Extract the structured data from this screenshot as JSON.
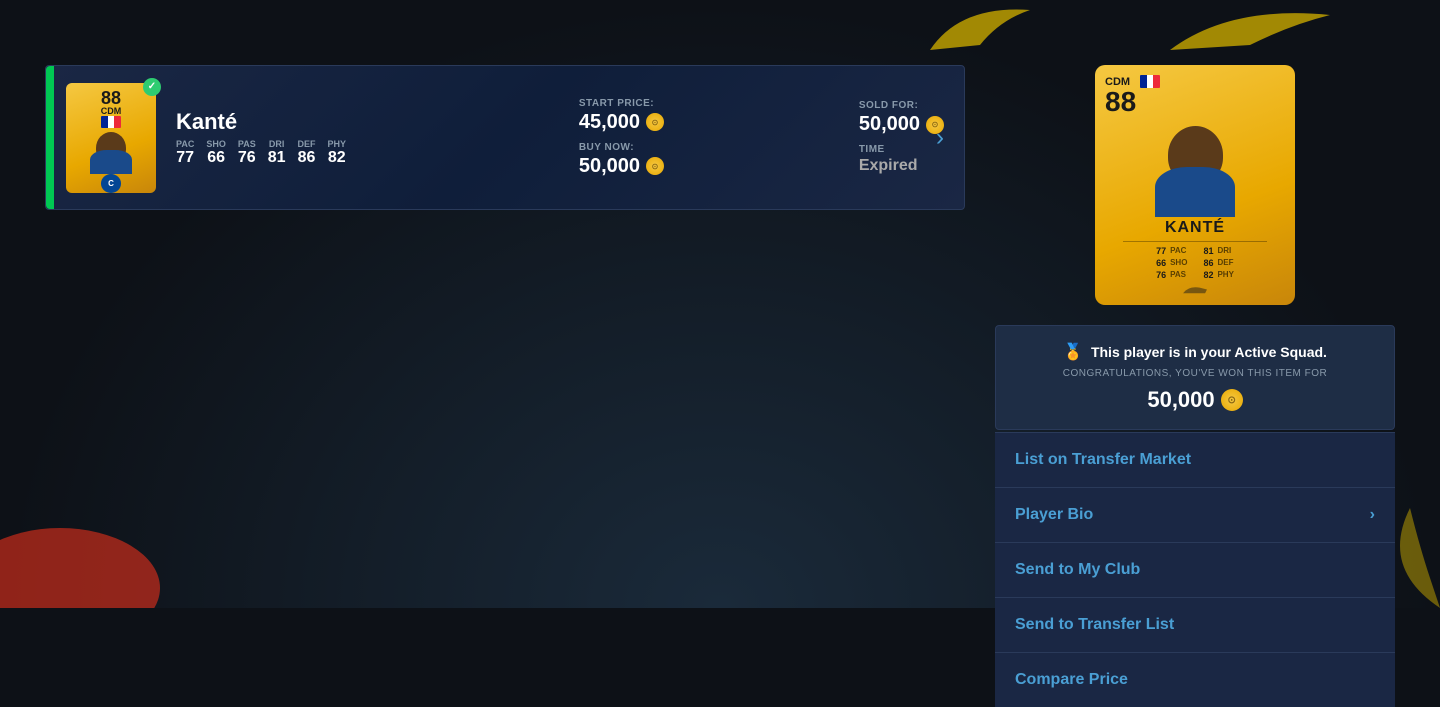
{
  "page": {
    "bg_color": "#0d1117"
  },
  "player": {
    "name": "Kanté",
    "rating": "88",
    "position": "CDM",
    "stats": {
      "pac_label": "PAC",
      "pac": "77",
      "sho_label": "SHO",
      "sho": "66",
      "pas_label": "PAS",
      "pas": "76",
      "dri_label": "DRI",
      "dri": "81",
      "def_label": "DEF",
      "def": "86",
      "phy_label": "PHY",
      "phy": "82"
    }
  },
  "listing": {
    "start_price_label": "START PRICE:",
    "start_price": "45,000",
    "buy_now_label": "BUY NOW:",
    "buy_now": "50,000",
    "sold_for_label": "SOLD FOR:",
    "sold_for": "50,000",
    "time_label": "TIME",
    "time_value": "Expired"
  },
  "notice": {
    "title": "This player is in your Active Squad.",
    "subtitle": "CONGRATULATIONS, YOU'VE WON THIS ITEM FOR",
    "price": "50,000"
  },
  "actions": {
    "list_transfer_market": "List on Transfer Market",
    "player_bio": "Player Bio",
    "send_my_club": "Send to My Club",
    "send_transfer_list": "Send to Transfer List",
    "compare_price": "Compare Price"
  },
  "big_card": {
    "position": "CDM",
    "rating": "88",
    "name": "KANTÉ",
    "stats": [
      {
        "label": "PAC",
        "value": "77"
      },
      {
        "label": "SHO",
        "value": "66"
      },
      {
        "label": "PAS",
        "value": "76"
      },
      {
        "label": "DRI",
        "value": "81"
      },
      {
        "label": "DEF",
        "value": "86"
      },
      {
        "label": "PHY",
        "value": "82"
      }
    ]
  }
}
